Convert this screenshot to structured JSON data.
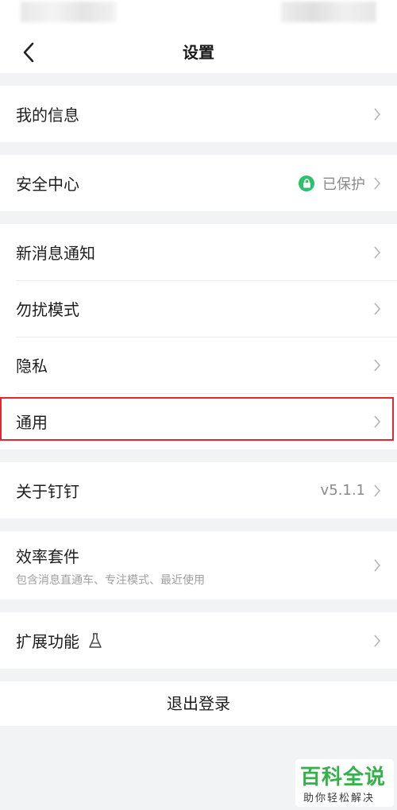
{
  "nav": {
    "title": "设置"
  },
  "groups": {
    "info": {
      "my_info": "我的信息"
    },
    "security": {
      "label": "安全中心",
      "status": "已保护"
    },
    "notify": {
      "items": [
        {
          "label": "新消息通知"
        },
        {
          "label": "勿扰模式"
        },
        {
          "label": "隐私"
        },
        {
          "label": "通用"
        }
      ]
    },
    "about": {
      "label": "关于钉钉",
      "version": "v5.1.1"
    },
    "efficiency": {
      "label": "效率套件",
      "sub": "包含消息直通车、专注模式、最近使用"
    },
    "extension": {
      "label": "扩展功能"
    }
  },
  "logout": {
    "label": "退出登录"
  },
  "watermark": {
    "main": "百科全说",
    "sub": "助你轻松解决"
  },
  "colors": {
    "accent_green": "#27c46b",
    "highlight_red": "#e0282e",
    "background": "#f2f3f5"
  },
  "icons": [
    "back-arrow-icon",
    "chevron-right-icon",
    "lock-icon",
    "flask-icon"
  ]
}
